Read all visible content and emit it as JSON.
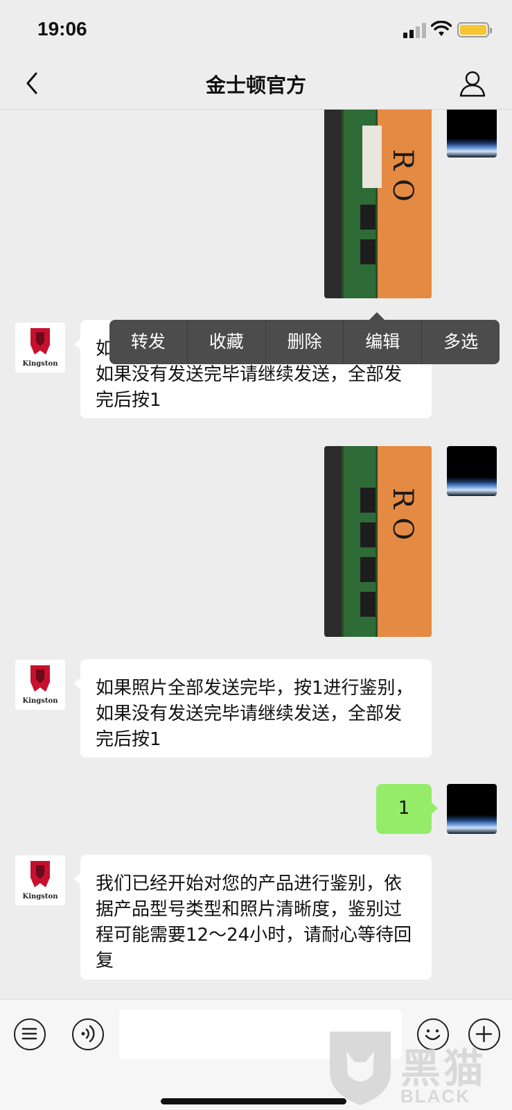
{
  "status": {
    "time": "19:06"
  },
  "nav": {
    "title": "金士顿官方"
  },
  "context_menu": {
    "items": [
      "转发",
      "收藏",
      "删除",
      "编辑",
      "多选"
    ]
  },
  "messages": {
    "m1": {
      "text": "如果照片全部发送完毕，按1进行鉴别，如果没有发送完毕请继续发送，全部发完后按1"
    },
    "m2": {
      "text": "如果照片全部发送完毕，按1进行鉴别，如果没有发送完毕请继续发送，全部发完后按1"
    },
    "m3": {
      "text": "1"
    },
    "m4": {
      "text": "我们已经开始对您的产品进行鉴别，依据产品型号类型和照片清晰度，鉴别过程可能需要12～24小时，请耐心等待回复"
    }
  },
  "brand_logo": {
    "text": "Kingston"
  },
  "watermark": {
    "cn": "黑猫",
    "en": "BLACK CAT"
  },
  "colors": {
    "accent_green": "#95ec69",
    "kingston_red": "#c8102e"
  }
}
